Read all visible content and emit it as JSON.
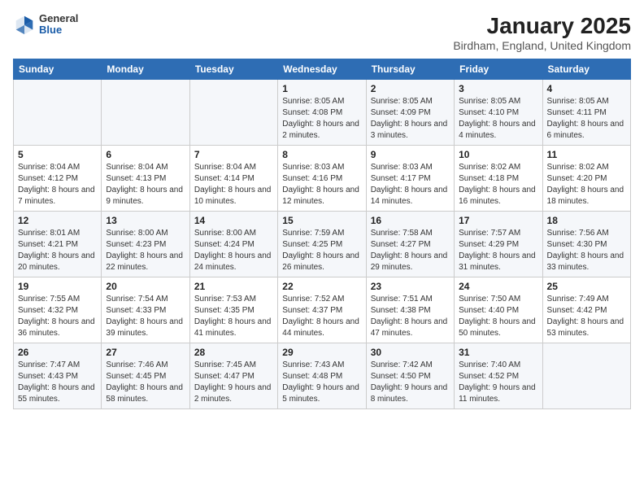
{
  "header": {
    "logo_general": "General",
    "logo_blue": "Blue",
    "month": "January 2025",
    "location": "Birdham, England, United Kingdom"
  },
  "weekdays": [
    "Sunday",
    "Monday",
    "Tuesday",
    "Wednesday",
    "Thursday",
    "Friday",
    "Saturday"
  ],
  "weeks": [
    [
      {
        "day": "",
        "info": ""
      },
      {
        "day": "",
        "info": ""
      },
      {
        "day": "",
        "info": ""
      },
      {
        "day": "1",
        "info": "Sunrise: 8:05 AM\nSunset: 4:08 PM\nDaylight: 8 hours and 2 minutes."
      },
      {
        "day": "2",
        "info": "Sunrise: 8:05 AM\nSunset: 4:09 PM\nDaylight: 8 hours and 3 minutes."
      },
      {
        "day": "3",
        "info": "Sunrise: 8:05 AM\nSunset: 4:10 PM\nDaylight: 8 hours and 4 minutes."
      },
      {
        "day": "4",
        "info": "Sunrise: 8:05 AM\nSunset: 4:11 PM\nDaylight: 8 hours and 6 minutes."
      }
    ],
    [
      {
        "day": "5",
        "info": "Sunrise: 8:04 AM\nSunset: 4:12 PM\nDaylight: 8 hours and 7 minutes."
      },
      {
        "day": "6",
        "info": "Sunrise: 8:04 AM\nSunset: 4:13 PM\nDaylight: 8 hours and 9 minutes."
      },
      {
        "day": "7",
        "info": "Sunrise: 8:04 AM\nSunset: 4:14 PM\nDaylight: 8 hours and 10 minutes."
      },
      {
        "day": "8",
        "info": "Sunrise: 8:03 AM\nSunset: 4:16 PM\nDaylight: 8 hours and 12 minutes."
      },
      {
        "day": "9",
        "info": "Sunrise: 8:03 AM\nSunset: 4:17 PM\nDaylight: 8 hours and 14 minutes."
      },
      {
        "day": "10",
        "info": "Sunrise: 8:02 AM\nSunset: 4:18 PM\nDaylight: 8 hours and 16 minutes."
      },
      {
        "day": "11",
        "info": "Sunrise: 8:02 AM\nSunset: 4:20 PM\nDaylight: 8 hours and 18 minutes."
      }
    ],
    [
      {
        "day": "12",
        "info": "Sunrise: 8:01 AM\nSunset: 4:21 PM\nDaylight: 8 hours and 20 minutes."
      },
      {
        "day": "13",
        "info": "Sunrise: 8:00 AM\nSunset: 4:23 PM\nDaylight: 8 hours and 22 minutes."
      },
      {
        "day": "14",
        "info": "Sunrise: 8:00 AM\nSunset: 4:24 PM\nDaylight: 8 hours and 24 minutes."
      },
      {
        "day": "15",
        "info": "Sunrise: 7:59 AM\nSunset: 4:25 PM\nDaylight: 8 hours and 26 minutes."
      },
      {
        "day": "16",
        "info": "Sunrise: 7:58 AM\nSunset: 4:27 PM\nDaylight: 8 hours and 29 minutes."
      },
      {
        "day": "17",
        "info": "Sunrise: 7:57 AM\nSunset: 4:29 PM\nDaylight: 8 hours and 31 minutes."
      },
      {
        "day": "18",
        "info": "Sunrise: 7:56 AM\nSunset: 4:30 PM\nDaylight: 8 hours and 33 minutes."
      }
    ],
    [
      {
        "day": "19",
        "info": "Sunrise: 7:55 AM\nSunset: 4:32 PM\nDaylight: 8 hours and 36 minutes."
      },
      {
        "day": "20",
        "info": "Sunrise: 7:54 AM\nSunset: 4:33 PM\nDaylight: 8 hours and 39 minutes."
      },
      {
        "day": "21",
        "info": "Sunrise: 7:53 AM\nSunset: 4:35 PM\nDaylight: 8 hours and 41 minutes."
      },
      {
        "day": "22",
        "info": "Sunrise: 7:52 AM\nSunset: 4:37 PM\nDaylight: 8 hours and 44 minutes."
      },
      {
        "day": "23",
        "info": "Sunrise: 7:51 AM\nSunset: 4:38 PM\nDaylight: 8 hours and 47 minutes."
      },
      {
        "day": "24",
        "info": "Sunrise: 7:50 AM\nSunset: 4:40 PM\nDaylight: 8 hours and 50 minutes."
      },
      {
        "day": "25",
        "info": "Sunrise: 7:49 AM\nSunset: 4:42 PM\nDaylight: 8 hours and 53 minutes."
      }
    ],
    [
      {
        "day": "26",
        "info": "Sunrise: 7:47 AM\nSunset: 4:43 PM\nDaylight: 8 hours and 55 minutes."
      },
      {
        "day": "27",
        "info": "Sunrise: 7:46 AM\nSunset: 4:45 PM\nDaylight: 8 hours and 58 minutes."
      },
      {
        "day": "28",
        "info": "Sunrise: 7:45 AM\nSunset: 4:47 PM\nDaylight: 9 hours and 2 minutes."
      },
      {
        "day": "29",
        "info": "Sunrise: 7:43 AM\nSunset: 4:48 PM\nDaylight: 9 hours and 5 minutes."
      },
      {
        "day": "30",
        "info": "Sunrise: 7:42 AM\nSunset: 4:50 PM\nDaylight: 9 hours and 8 minutes."
      },
      {
        "day": "31",
        "info": "Sunrise: 7:40 AM\nSunset: 4:52 PM\nDaylight: 9 hours and 11 minutes."
      },
      {
        "day": "",
        "info": ""
      }
    ]
  ]
}
